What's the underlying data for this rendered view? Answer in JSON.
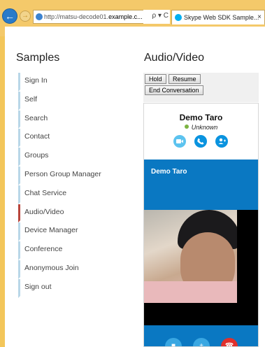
{
  "browser": {
    "url_prefix": "http://matsu-decode01.",
    "url_host": "example.c...",
    "addr_tools": "ρ ▾ C",
    "tab_title": "Skype Web SDK Sample...",
    "tab_close": "×"
  },
  "sidebar": {
    "title": "Samples",
    "items": [
      {
        "label": "Sign In"
      },
      {
        "label": "Self"
      },
      {
        "label": "Search"
      },
      {
        "label": "Contact"
      },
      {
        "label": "Groups"
      },
      {
        "label": "Person Group Manager"
      },
      {
        "label": "Chat Service"
      },
      {
        "label": "Audio/Video"
      },
      {
        "label": "Device Manager"
      },
      {
        "label": "Conference"
      },
      {
        "label": "Anonymous Join"
      },
      {
        "label": "Sign out"
      }
    ],
    "active_index": 7
  },
  "main": {
    "title": "Audio/Video",
    "buttons": {
      "hold": "Hold",
      "resume": "Resume",
      "end": "End Conversation"
    },
    "conversation": {
      "participant_name": "Demo  Taro",
      "presence": "Unknown",
      "video_header_name": "Demo  Taro"
    }
  },
  "icons": {
    "video": "video-camera-icon",
    "call": "phone-icon",
    "add_person": "add-person-icon",
    "hang_up": "hang-up-icon"
  },
  "colors": {
    "accent": "#0a78c2",
    "active_marker": "#b8453b",
    "side_marker": "#b9d7e8",
    "hang_up": "#e0302c",
    "presence": "#7cb342"
  }
}
